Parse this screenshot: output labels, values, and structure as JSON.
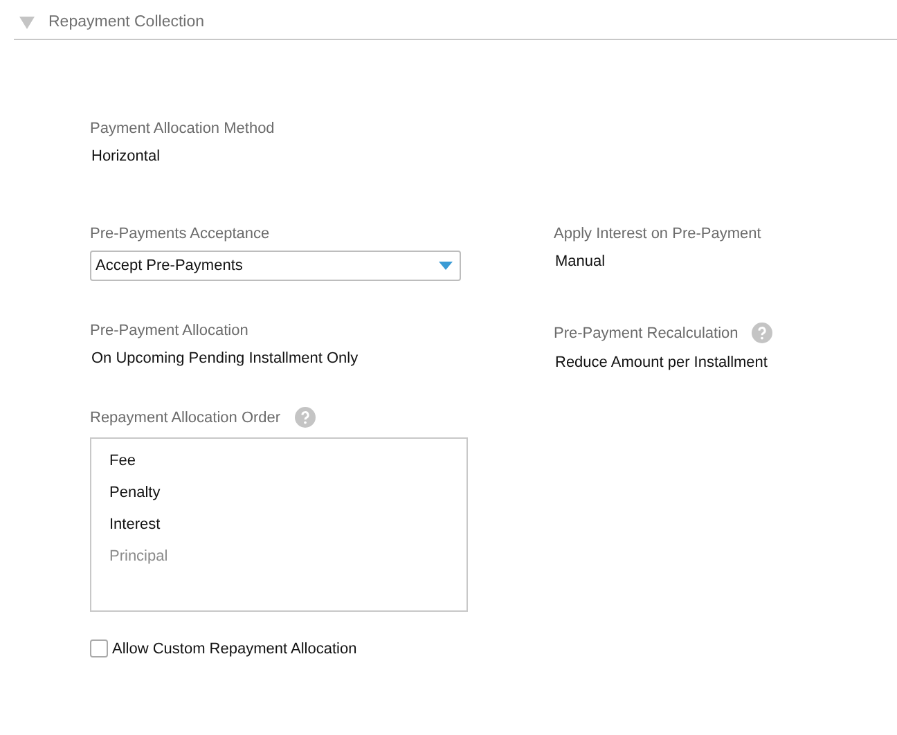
{
  "section": {
    "title": "Repayment Collection",
    "expanded": true
  },
  "payment_allocation_method": {
    "label": "Payment Allocation Method",
    "value": "Horizontal"
  },
  "pre_payments_acceptance": {
    "label": "Pre-Payments Acceptance",
    "value": "Accept Pre-Payments"
  },
  "apply_interest_on_pre_payment": {
    "label": "Apply Interest on Pre-Payment",
    "value": "Manual"
  },
  "pre_payment_allocation": {
    "label": "Pre-Payment Allocation",
    "value": "On Upcoming Pending Installment Only"
  },
  "pre_payment_recalculation": {
    "label": "Pre-Payment Recalculation",
    "value": "Reduce Amount per Installment",
    "help": true
  },
  "repayment_allocation_order": {
    "label": "Repayment Allocation Order",
    "help": true,
    "items": [
      {
        "label": "Fee",
        "disabled": false
      },
      {
        "label": "Penalty",
        "disabled": false
      },
      {
        "label": "Interest",
        "disabled": false
      },
      {
        "label": "Principal",
        "disabled": true
      }
    ]
  },
  "allow_custom_repayment_allocation": {
    "label": "Allow Custom Repayment Allocation",
    "checked": false
  }
}
